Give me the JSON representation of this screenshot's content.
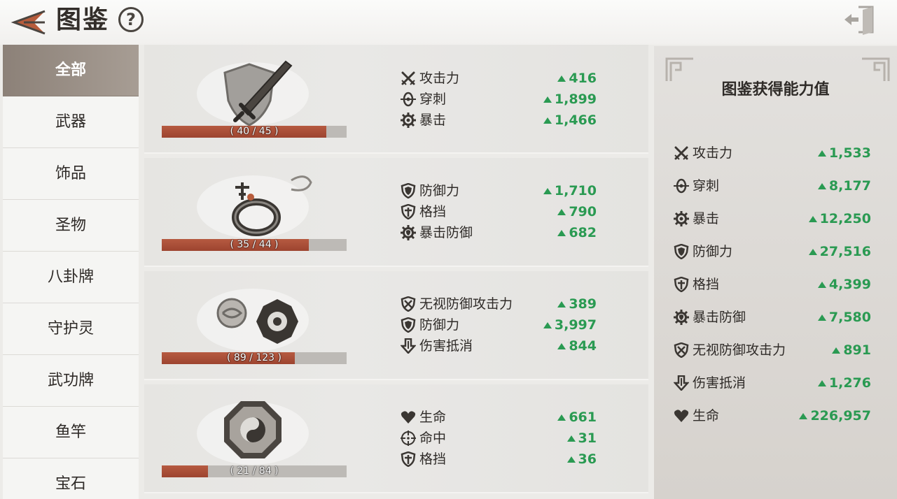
{
  "header": {
    "title": "图鉴",
    "help_label": "?"
  },
  "sidebar": {
    "items": [
      {
        "label": "全部",
        "active": true
      },
      {
        "label": "武器"
      },
      {
        "label": "饰品"
      },
      {
        "label": "圣物"
      },
      {
        "label": "八卦牌"
      },
      {
        "label": "守护灵"
      },
      {
        "label": "武功牌"
      },
      {
        "label": "鱼竿"
      },
      {
        "label": "宝石"
      }
    ]
  },
  "cards": [
    {
      "progress_text": "( 40 / 45 )",
      "progress": 0.89,
      "stats": [
        {
          "icon": "swords-icon",
          "name": "攻击力",
          "value": "416"
        },
        {
          "icon": "penetration-icon",
          "name": "穿刺",
          "value": "1,899"
        },
        {
          "icon": "gear-icon",
          "name": "暴击",
          "value": "1,466"
        }
      ]
    },
    {
      "progress_text": "( 35 / 44 )",
      "progress": 0.795,
      "stats": [
        {
          "icon": "shield-icon",
          "name": "防御力",
          "value": "1,710"
        },
        {
          "icon": "block-shield-icon",
          "name": "格挡",
          "value": "790"
        },
        {
          "icon": "crit-defense-icon",
          "name": "暴击防御",
          "value": "682"
        }
      ]
    },
    {
      "progress_text": "( 89 / 123 )",
      "progress": 0.72,
      "stats": [
        {
          "icon": "ignore-defense-icon",
          "name": "无视防御攻击力",
          "value": "389"
        },
        {
          "icon": "shield-icon",
          "name": "防御力",
          "value": "3,997"
        },
        {
          "icon": "damage-reduction-icon",
          "name": "伤害抵消",
          "value": "844"
        }
      ]
    },
    {
      "progress_text": "( 21 / 84 )",
      "progress": 0.25,
      "stats": [
        {
          "icon": "heart-icon",
          "name": "生命",
          "value": "661"
        },
        {
          "icon": "crosshair-icon",
          "name": "命中",
          "value": "31"
        },
        {
          "icon": "block-shield-icon",
          "name": "格挡",
          "value": "36"
        }
      ]
    }
  ],
  "summary": {
    "title": "图鉴获得能力值",
    "stats": [
      {
        "icon": "swords-icon",
        "name": "攻击力",
        "value": "1,533"
      },
      {
        "icon": "penetration-icon",
        "name": "穿刺",
        "value": "8,177"
      },
      {
        "icon": "gear-icon",
        "name": "暴击",
        "value": "12,250"
      },
      {
        "icon": "shield-icon",
        "name": "防御力",
        "value": "27,516"
      },
      {
        "icon": "block-shield-icon",
        "name": "格挡",
        "value": "4,399"
      },
      {
        "icon": "crit-defense-icon",
        "name": "暴击防御",
        "value": "7,580"
      },
      {
        "icon": "ignore-defense-icon",
        "name": "无视防御攻击力",
        "value": "891"
      },
      {
        "icon": "damage-reduction-icon",
        "name": "伤害抵消",
        "value": "1,276"
      },
      {
        "icon": "heart-icon",
        "name": "生命",
        "value": "226,957"
      }
    ]
  },
  "colors": {
    "accent_green": "#2a9a52",
    "progress_red": "#a84a34",
    "sidebar_active": "#978c83"
  }
}
